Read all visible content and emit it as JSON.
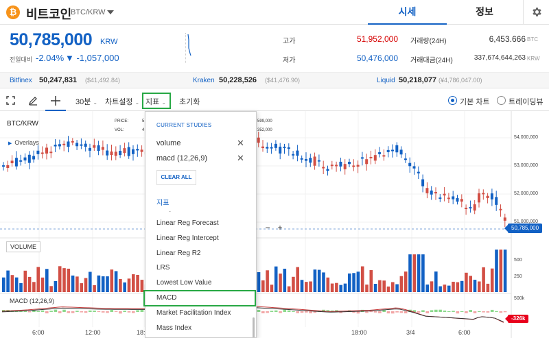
{
  "header": {
    "coin_symbol": "₿",
    "coin_name": "비트코인",
    "pair": "BTC/KRW",
    "tabs": [
      {
        "label": "시세",
        "active": true
      },
      {
        "label": "정보",
        "active": false
      }
    ]
  },
  "price": {
    "value": "50,785,000",
    "currency": "KRW",
    "change_label": "전일대비",
    "change_rate": "-2.04%",
    "change_amount": "▼ -1,057,000"
  },
  "stats": {
    "high_label": "고가",
    "high_value": "51,952,000",
    "low_label": "저가",
    "low_value": "50,476,000",
    "volume_label": "거래량(24H)",
    "volume_value": "6,453.666",
    "volume_unit": "BTC",
    "amount_label": "거래대금(24H)",
    "amount_value": "337,674,644,263",
    "amount_unit": "KRW"
  },
  "exchanges": [
    {
      "name": "Bitfinex",
      "price": "50,247,831",
      "usd": "($41,492.84)"
    },
    {
      "name": "Kraken",
      "price": "50,228,526",
      "usd": "($41,476.90)"
    },
    {
      "name": "Liquid",
      "price": "50,218,077",
      "usd": "(¥4,786,047.00)"
    }
  ],
  "toolbar": {
    "interval": "30분",
    "chart_settings": "차트설정",
    "indicators": "지표",
    "reset": "초기화",
    "chart_basic": "기본 차트",
    "chart_tradingview": "트레이딩뷰"
  },
  "chart": {
    "symbol": "BTC/KRW",
    "overlays": "Overlays",
    "price_label": "PRICE:",
    "price_fragment": "5",
    "vol_label": "VOL:",
    "vol_fragment": "4",
    "hover_price": "599,000",
    "hover_vol": "352,000",
    "volume_panel": "VOLUME",
    "macd_panel": "MACD (12,26,9)",
    "last_price_tag": "50,785,000",
    "macd_value_tag": "-326k",
    "y_price_labels": [
      "54,000,000",
      "53,000,000",
      "52,000,000",
      "51,000,000"
    ],
    "y_vol_labels": [
      "500",
      "250"
    ],
    "y_macd_label": "500k",
    "x_labels": [
      "6:00",
      "12:00",
      "18:00",
      "18:00",
      "3/4",
      "6:00"
    ],
    "zoom_minus": "−",
    "zoom_plus": "+",
    "up_color": "#d24f45",
    "down_color": "#1261c4"
  },
  "studies_menu": {
    "current_heading": "CURRENT STUDIES",
    "current": [
      "volume",
      "macd (12,26,9)"
    ],
    "clear_all": "CLEAR ALL",
    "section": "지표",
    "separator": "-",
    "items": [
      "Linear Reg Forecast",
      "Linear Reg Intercept",
      "Linear Reg R2",
      "LRS",
      "Lowest Low Value",
      "MACD",
      "Market Facilitation Index",
      "Mass Index"
    ],
    "highlighted": "MACD"
  }
}
